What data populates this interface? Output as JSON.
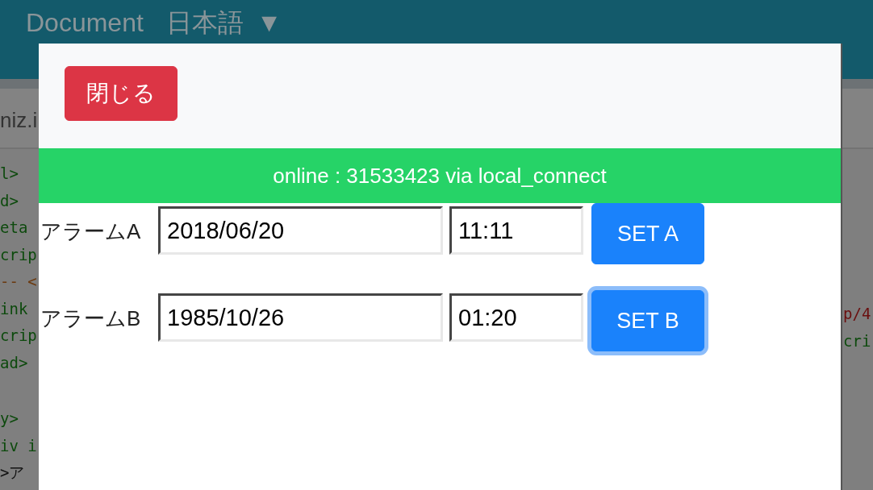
{
  "background": {
    "header": {
      "title": "Document",
      "language": "日本語",
      "caret": "▼"
    },
    "tab": "niz.i",
    "code_left_blocks": [
      {
        "lines": [
          {
            "text": "l>",
            "color": "#0d4a0d"
          },
          {
            "text": "d>",
            "color": "#0d4a0d"
          },
          {
            "text": "eta",
            "color": "#0d4a0d"
          },
          {
            "text": "crip",
            "color": "#0d4a0d"
          },
          {
            "text": "-- <",
            "color": "#6b3a10"
          },
          {
            "text": "ink",
            "color": "#0d4a0d"
          },
          {
            "text": "crip",
            "color": "#0d4a0d"
          },
          {
            "text": "ad>",
            "color": "#0d4a0d"
          }
        ]
      },
      {
        "lines": [
          {
            "text": "y>",
            "color": "#0d4a0d"
          },
          {
            "text": "iv i",
            "color": "#0d4a0d"
          },
          {
            "text": ">ア",
            "color": "#111111"
          }
        ]
      }
    ],
    "code_right": [
      {
        "text": "p/4",
        "color": "#6a0f0f"
      },
      {
        "text": "cri",
        "color": "#0d4a0d"
      }
    ]
  },
  "modal": {
    "close_button": "閉じる",
    "status": "online : 31533423 via local_connect",
    "alarms": [
      {
        "label": "アラームA",
        "date": "2018/06/20",
        "time": "11:11",
        "button": "SET A",
        "focused": false
      },
      {
        "label": "アラームB",
        "date": "1985/10/26",
        "time": "01:20",
        "button": "SET B",
        "focused": true
      }
    ]
  }
}
